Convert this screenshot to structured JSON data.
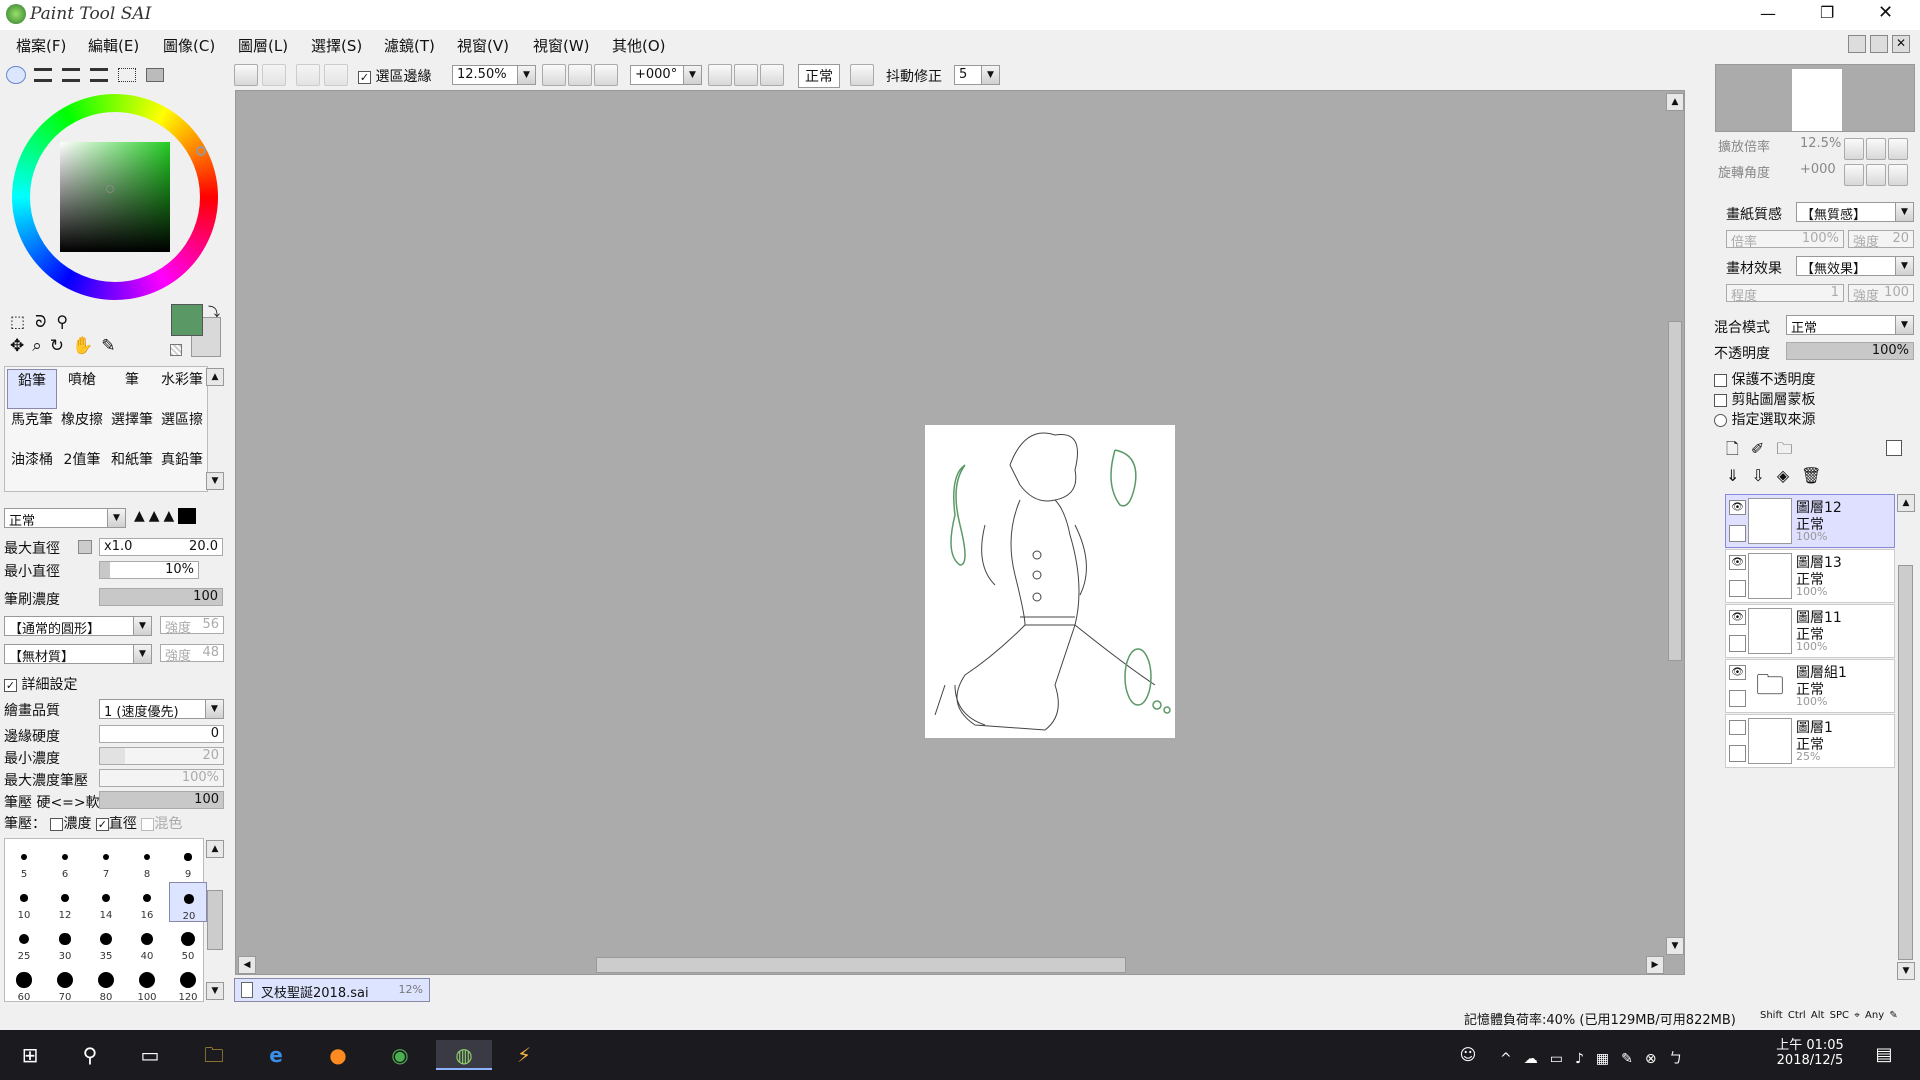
{
  "window": {
    "app_name": "Paint Tool SAI"
  },
  "menu": [
    "檔案(F)",
    "編輯(E)",
    "圖像(C)",
    "圖層(L)",
    "選擇(S)",
    "濾鏡(T)",
    "視窗(V)",
    "視窗(W)",
    "其他(O)"
  ],
  "toolbar": {
    "selection_edge_label": "選區邊緣",
    "zoom_value": "12.50%",
    "rotation_value": "+000°",
    "mode_label": "正常",
    "stabilizer_label": "抖動修正",
    "stabilizer_value": "5"
  },
  "tools": [
    "鉛筆",
    "噴槍",
    "筆",
    "水彩筆",
    "馬克筆",
    "橡皮擦",
    "選擇筆",
    "選區擦",
    "油漆桶",
    "2值筆",
    "和紙筆",
    "真鉛筆"
  ],
  "brush": {
    "blend_mode": "正常",
    "max_size_label": "最大直徑",
    "max_size_mult": "x1.0",
    "max_size_value": "20.0",
    "min_size_label": "最小直徑",
    "min_size_value": "10%",
    "density_label": "筆刷濃度",
    "density_value": "100",
    "shape": "【通常的圓形】",
    "shape_strength_label": "強度",
    "shape_strength": "56",
    "texture": "【無材質】",
    "texture_strength_label": "強度",
    "texture_strength": "48",
    "advanced_label": "詳細設定",
    "quality_label": "繪畫品質",
    "quality_value": "1 (速度優先)",
    "edge_label": "邊緣硬度",
    "edge_value": "0",
    "min_density_label": "最小濃度",
    "min_density_value": "20",
    "max_pressure_label": "最大濃度筆壓",
    "max_pressure_value": "100%",
    "pressure_hardness_label": "筆壓 硬<=>軟",
    "pressure_hardness_value": "100",
    "pressure_label": "筆壓：",
    "pressure_density": "濃度",
    "pressure_size": "直徑",
    "pressure_blend": "混色"
  },
  "brush_sizes": [
    "5",
    "6",
    "7",
    "8",
    "9",
    "10",
    "12",
    "14",
    "16",
    "20",
    "25",
    "30",
    "35",
    "40",
    "50",
    "60",
    "70",
    "80",
    "100",
    "120"
  ],
  "document_tab": {
    "name": "叉枝聖誕2018.sai",
    "zoom": "12%"
  },
  "navigator": {
    "zoom_label": "擴放倍率",
    "zoom_value": "12.5%",
    "angle_label": "旋轉角度",
    "angle_value": "+000"
  },
  "paper": {
    "texture_label": "畫紙質感",
    "texture_value": "【無質感】",
    "scale_label": "倍率",
    "scale_value": "100%",
    "strength_label": "強度",
    "strength_value": "20",
    "effect_label": "畫材效果",
    "effect_value": "【無效果】",
    "degree_label": "程度",
    "degree_value": "1",
    "effect_strength_label": "強度",
    "effect_strength_value": "100"
  },
  "layer_props": {
    "blend_label": "混合模式",
    "blend_value": "正常",
    "opacity_label": "不透明度",
    "opacity_value": "100%",
    "opacity_fraction": 1.0,
    "preserve_opacity": "保護不透明度",
    "clipping": "剪貼圖層蒙板",
    "selection_source": "指定選取來源"
  },
  "layers": [
    {
      "name": "圖層12",
      "mode": "正常",
      "opacity": "100%",
      "selected": true
    },
    {
      "name": "圖層13",
      "mode": "正常",
      "opacity": "100%",
      "selected": false
    },
    {
      "name": "圖層11",
      "mode": "正常",
      "opacity": "100%",
      "selected": false
    },
    {
      "name": "圖層組1",
      "mode": "正常",
      "opacity": "100%",
      "selected": false
    },
    {
      "name": "圖層1",
      "mode": "正常",
      "opacity": "25%",
      "selected": false
    }
  ],
  "status": {
    "memory": "記憶體負荷率:40% (已用129MB/可用822MB)",
    "keys": [
      "Shift",
      "Ctrl",
      "Alt",
      "SPC",
      "Any"
    ]
  },
  "taskbar": {
    "time": "上午 01:05",
    "date": "2018/12/5"
  },
  "colors": {
    "current": "#5a9966",
    "secondary": "#d9d9d9",
    "canvas_bg": "#ababab",
    "sketch_line": "#5a9966"
  }
}
